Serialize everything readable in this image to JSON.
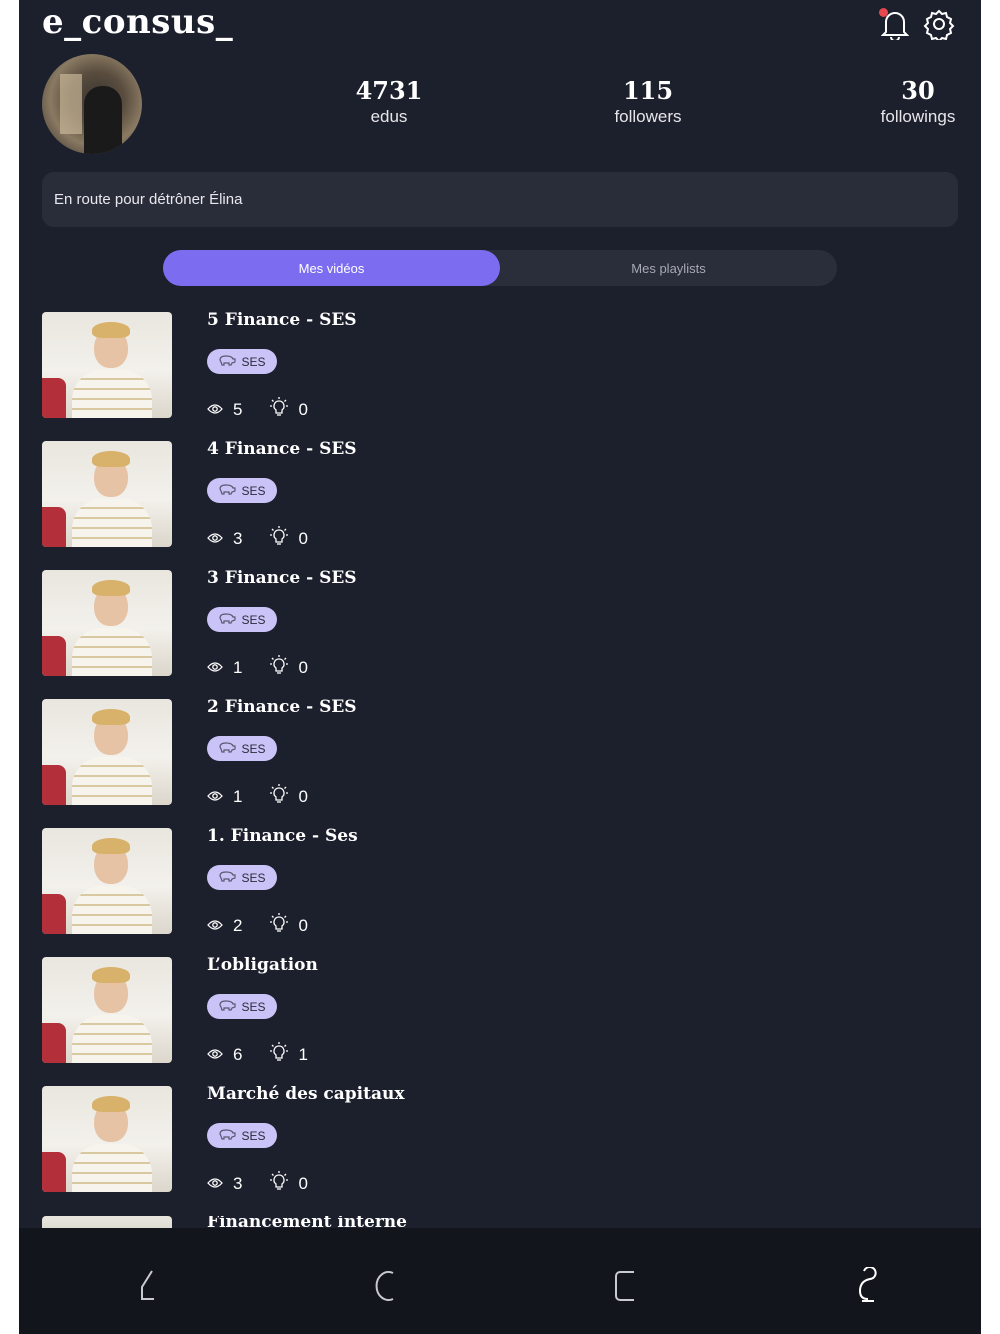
{
  "profile": {
    "username": "e_consus_",
    "stats": [
      {
        "value": "4731",
        "label": "edus"
      },
      {
        "value": "115",
        "label": "followers"
      },
      {
        "value": "30",
        "label": "followings"
      }
    ],
    "bio": "En route pour détrôner Élina"
  },
  "header": {
    "icons": [
      "bell-icon",
      "gear-icon"
    ],
    "notification_dot_color": "#e5484d"
  },
  "tabs": [
    {
      "label": "Mes vidéos",
      "active": true
    },
    {
      "label": "Mes playlists",
      "active": false
    }
  ],
  "videos": [
    {
      "title": "5 Finance - SES",
      "tag": "SES",
      "views": "5",
      "ideas": "0"
    },
    {
      "title": "4 Finance - SES",
      "tag": "SES",
      "views": "3",
      "ideas": "0"
    },
    {
      "title": "3 Finance - SES",
      "tag": "SES",
      "views": "1",
      "ideas": "0"
    },
    {
      "title": "2 Finance - SES",
      "tag": "SES",
      "views": "1",
      "ideas": "0"
    },
    {
      "title": "1. Finance - Ses",
      "tag": "SES",
      "views": "2",
      "ideas": "0"
    },
    {
      "title": "L’obligation",
      "tag": "SES",
      "views": "6",
      "ideas": "1"
    },
    {
      "title": "Marché des capitaux",
      "tag": "SES",
      "views": "3",
      "ideas": "0"
    }
  ],
  "partial_video": {
    "title": "Financement interne"
  },
  "nav": [
    "back-icon",
    "refresh-icon",
    "square-icon",
    "profile-swirl-icon"
  ],
  "colors": {
    "accent": "#7b6cf0",
    "chip": "#c9c3f7",
    "background": "#1c1f2c"
  }
}
